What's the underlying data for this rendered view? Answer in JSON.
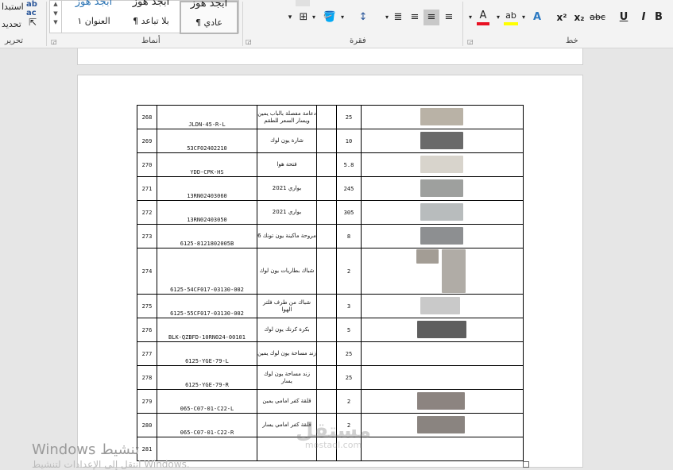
{
  "ribbon": {
    "groups": {
      "editing": "تحرير",
      "styles": "أنماط",
      "paragraph": "فقرة",
      "font": "خط"
    },
    "editing": {
      "replace_label": "استبدا",
      "select_label": "تحديد"
    },
    "styles": {
      "items": [
        {
          "preview": "أبجد هوز",
          "name": "¶ عادي",
          "active": true
        },
        {
          "preview": "أبجد هوز",
          "name": "¶ بلا تباعد",
          "active": false
        },
        {
          "preview": "أبجد هوز",
          "name": "العنوان ١",
          "active": false
        }
      ]
    },
    "font_buttons": {
      "bold": "B",
      "italic": "I",
      "underline": "U",
      "strikethrough": "abc",
      "subscript": "x₂",
      "superscript": "x²",
      "text_effects": "A",
      "highlight": "ab",
      "font_color": "A"
    },
    "colors": {
      "font_color_bar": "#e81123",
      "highlight_bar": "#ffff00"
    }
  },
  "table": {
    "rows": [
      {
        "num": "268",
        "code": "JLDN-45-R-L",
        "desc": "دعامة مفصلة بالباب يمين ويسار السعر للطقم",
        "qty": "25",
        "images": 1
      },
      {
        "num": "269",
        "code": "53CF02402210",
        "desc": "شارة يون لوك",
        "qty": "10",
        "images": 1
      },
      {
        "num": "270",
        "code": "YDD-CPK-HS",
        "desc": "فتحة هوا",
        "qty": "5.8",
        "images": 1
      },
      {
        "num": "271",
        "code": "13RN02403060",
        "desc": "بواري 2021",
        "qty": "245",
        "images": 1
      },
      {
        "num": "272",
        "code": "13RN02403050",
        "desc": "بواري 2021",
        "qty": "305",
        "images": 1
      },
      {
        "num": "273",
        "code": "6125-8121802005B",
        "desc": "مروحة ماكينة يون تونك 6",
        "qty": "8",
        "images": 1
      },
      {
        "num": "274",
        "code": "6125-54CF017-03130-002",
        "desc": "شباك بطاريات يون لوك",
        "qty": "2",
        "images": 2
      },
      {
        "num": "275",
        "code": "6125-55CF017-03130-002",
        "desc": "شباك من طرف فلتر الهوا",
        "qty": "3",
        "images": 1
      },
      {
        "num": "276",
        "code": "BLK-QZBFD-10RN024-00101",
        "desc": "بكرة كرنك يون لوك",
        "qty": "5",
        "images": 1
      },
      {
        "num": "277",
        "code": "6125-YGE-79-L",
        "desc": "زند مساحة يون لوك يمين",
        "qty": "25",
        "images": 0
      },
      {
        "num": "278",
        "code": "6125-YGE-79-R",
        "desc": "زند مساحة يون لوك يسار",
        "qty": "25",
        "images": 0
      },
      {
        "num": "279",
        "code": "065-C07-01-C22-L",
        "desc": "قلقة كفر امامي يمين",
        "qty": "2",
        "images": 1
      },
      {
        "num": "280",
        "code": "065-C07-01-C22-R",
        "desc": "قلقة كفر امامي يسار",
        "qty": "2",
        "images": 1
      },
      {
        "num": "281",
        "code": "",
        "desc": "",
        "qty": "",
        "images": 0
      }
    ]
  },
  "watermarks": {
    "windows_activate": "تنشيط Windows",
    "windows_sub": "انتقل إلى الإعدادات لتنشيط Windows.",
    "mostaql_ar": "مستقل",
    "mostaql_en": "mostaql.com"
  }
}
